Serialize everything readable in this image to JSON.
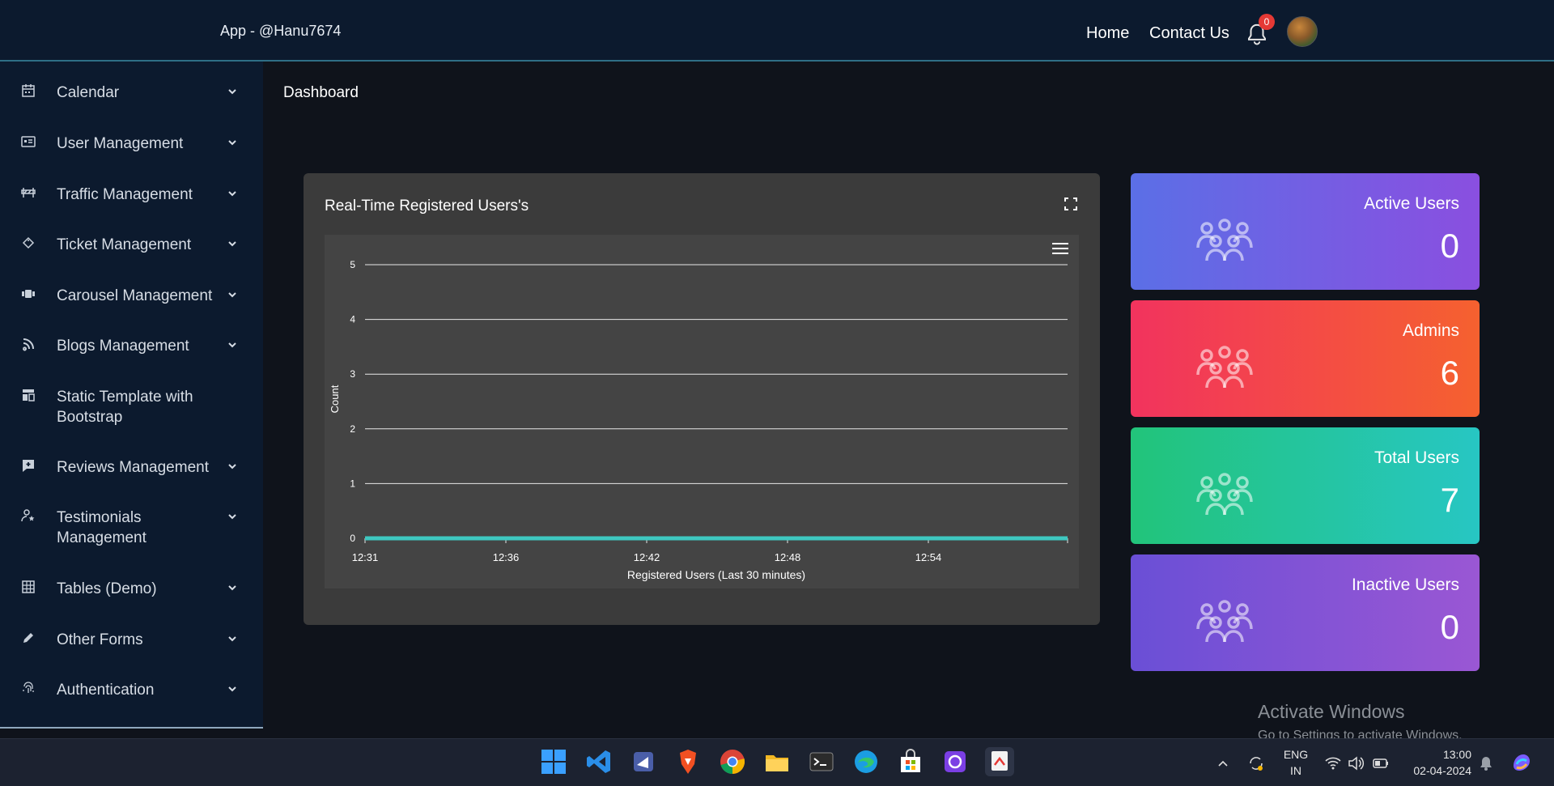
{
  "header": {
    "app_title": "App - @Hanu7674",
    "nav": {
      "home": "Home",
      "contact": "Contact Us"
    },
    "notification_count": "0"
  },
  "sidebar": {
    "items": [
      {
        "label": "Calendar",
        "icon": "calendar-icon",
        "has_chevron": true
      },
      {
        "label": "User Management",
        "icon": "id-card-icon",
        "has_chevron": true
      },
      {
        "label": "Traffic Management",
        "icon": "barrier-icon",
        "has_chevron": true
      },
      {
        "label": "Ticket Management",
        "icon": "ticket-icon",
        "has_chevron": true
      },
      {
        "label": "Carousel Management",
        "icon": "carousel-icon",
        "has_chevron": true
      },
      {
        "label": "Blogs Management",
        "icon": "rss-icon",
        "has_chevron": true
      },
      {
        "label": "Static Template with Bootstrap",
        "icon": "layout-icon",
        "has_chevron": false
      },
      {
        "label": "Reviews Management",
        "icon": "review-icon",
        "has_chevron": true
      },
      {
        "label": "Testimonials Management",
        "icon": "user-star-icon",
        "has_chevron": true
      },
      {
        "label": "Tables (Demo)",
        "icon": "table-icon",
        "has_chevron": true
      },
      {
        "label": "Other Forms",
        "icon": "pencil-icon",
        "has_chevron": true
      },
      {
        "label": "Authentication",
        "icon": "fingerprint-icon",
        "has_chevron": true
      }
    ]
  },
  "main": {
    "breadcrumb": "Dashboard"
  },
  "chart_card": {
    "title": "Real-Time Registered Users's"
  },
  "chart_data": {
    "type": "line",
    "title": "Real-Time Registered Users's",
    "xlabel": "Registered Users (Last 30 minutes)",
    "ylabel": "Count",
    "x_ticks": [
      "12:31",
      "12:36",
      "12:42",
      "12:48",
      "12:54"
    ],
    "y_ticks": [
      "0",
      "1",
      "2",
      "3",
      "4",
      "5"
    ],
    "ylim": [
      0,
      5
    ],
    "series": [
      {
        "values": [
          0,
          0,
          0,
          0,
          0,
          0
        ]
      }
    ],
    "line_color": "#3ec7c0",
    "grid": true
  },
  "stats": [
    {
      "title": "Active Users",
      "value": "0",
      "gradient": [
        "#5b6fe6",
        "#8a4fe0"
      ]
    },
    {
      "title": "Admins",
      "value": "6",
      "gradient": [
        "#f2335e",
        "#f5612f"
      ]
    },
    {
      "title": "Total Users",
      "value": "7",
      "gradient": [
        "#22c47a",
        "#27c6c3"
      ]
    },
    {
      "title": "Inactive Users",
      "value": "0",
      "gradient": [
        "#6a4fd6",
        "#9a57d4"
      ]
    }
  ],
  "watermark": {
    "title": "Activate Windows",
    "subtitle": "Go to Settings to activate Windows."
  },
  "taskbar": {
    "lang_top": "ENG",
    "lang_bottom": "IN",
    "time": "13:00",
    "date": "02-04-2024"
  }
}
